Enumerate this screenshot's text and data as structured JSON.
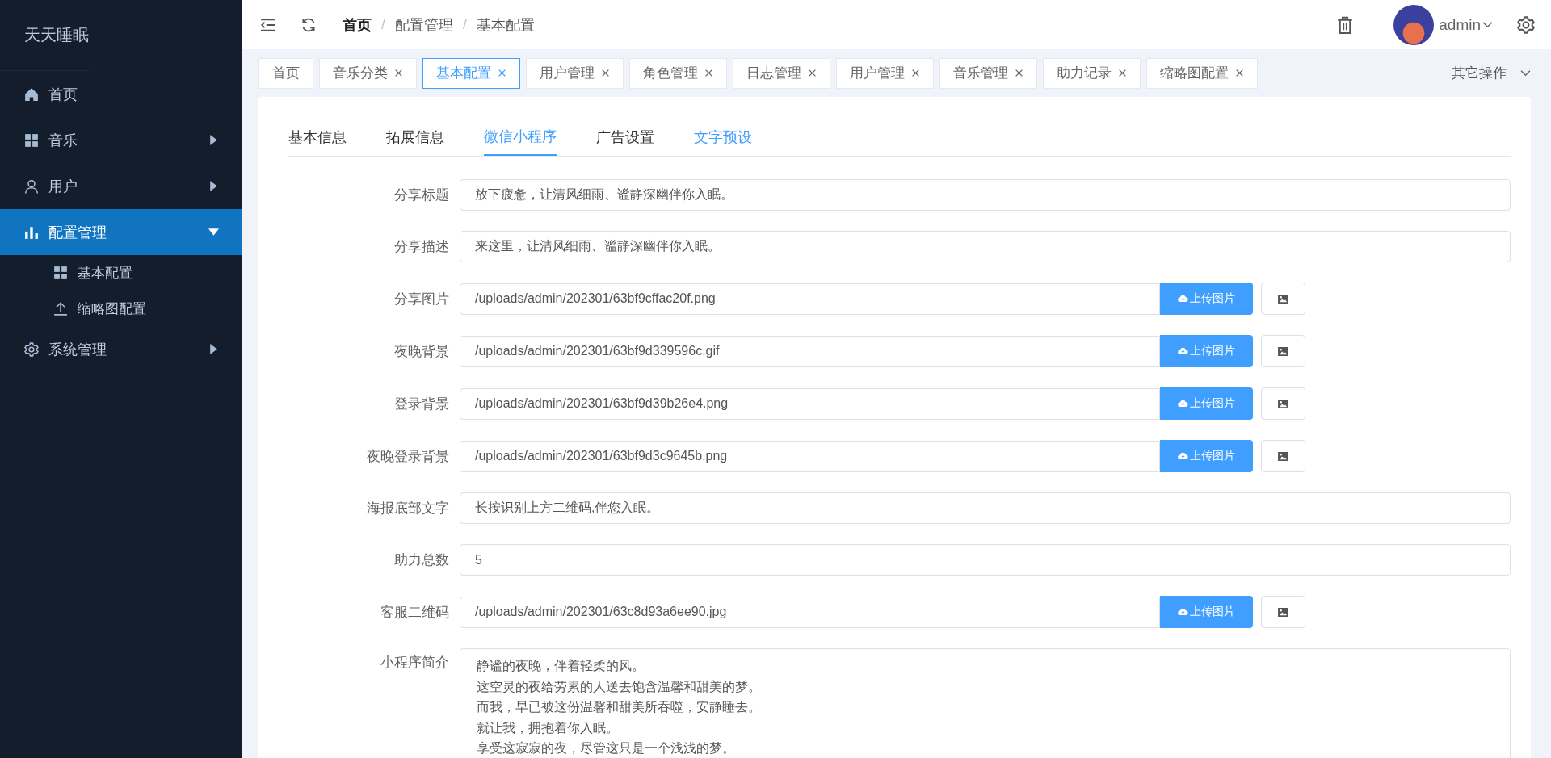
{
  "sidebar": {
    "title": "天天睡眠",
    "items": [
      {
        "label": "首页",
        "selected": false
      },
      {
        "label": "音乐",
        "selected": false,
        "expanded": false
      },
      {
        "label": "用户",
        "selected": false,
        "expanded": false
      },
      {
        "label": "配置管理",
        "selected": true,
        "expanded": true,
        "children": [
          {
            "label": "基本配置",
            "selected": false
          },
          {
            "label": "缩略图配置",
            "selected": false
          }
        ]
      },
      {
        "label": "系统管理",
        "selected": false,
        "expanded": false
      }
    ]
  },
  "header": {
    "breadcrumb": [
      {
        "label": "首页"
      },
      {
        "separator": "/",
        "label": "配置管理"
      },
      {
        "separator": "/",
        "label": "基本配置"
      }
    ],
    "user": "admin"
  },
  "tabs": [
    {
      "label": "首页",
      "closable": false,
      "selected": false
    },
    {
      "label": "音乐分类",
      "closable": true,
      "selected": false
    },
    {
      "label": "基本配置",
      "closable": true,
      "selected": true
    },
    {
      "label": "用户管理",
      "closable": true,
      "selected": false
    },
    {
      "label": "角色管理",
      "closable": true,
      "selected": false
    },
    {
      "label": "日志管理",
      "closable": true,
      "selected": false
    },
    {
      "label": "用户管理",
      "closable": true,
      "selected": false
    },
    {
      "label": "音乐管理",
      "closable": true,
      "selected": false
    },
    {
      "label": "助力记录",
      "closable": true,
      "selected": false
    },
    {
      "label": "缩略图配置",
      "closable": true,
      "selected": false
    }
  ],
  "tab_actions": "其它操作",
  "section_tabs": [
    {
      "label": "基本信息",
      "selected": false
    },
    {
      "label": "拓展信息",
      "selected": false
    },
    {
      "label": "微信小程序",
      "selected": true
    },
    {
      "label": "广告设置",
      "selected": false
    },
    {
      "label": "文字预设",
      "selected": false
    }
  ],
  "form": [
    {
      "kind": "text",
      "label": "分享标题",
      "value": "放下疲惫，让清风细雨、谧静深幽伴你入眠。"
    },
    {
      "kind": "text",
      "label": "分享描述",
      "value": "来这里，让清风细雨、谧静深幽伴你入眠。"
    },
    {
      "kind": "image",
      "label": "分享图片",
      "value": "/uploads/admin/202301/63bf9cffac20f.png",
      "button": "上传图片"
    },
    {
      "kind": "image",
      "label": "夜晚背景",
      "value": "/uploads/admin/202301/63bf9d339596c.gif",
      "button": "上传图片"
    },
    {
      "kind": "image",
      "label": "登录背景",
      "value": "/uploads/admin/202301/63bf9d39b26e4.png",
      "button": "上传图片"
    },
    {
      "kind": "image",
      "label": "夜晚登录背景",
      "value": "/uploads/admin/202301/63bf9d3c9645b.png",
      "button": "上传图片"
    },
    {
      "kind": "text",
      "label": "海报底部文字",
      "value": "长按识别上方二维码,伴您入眠。"
    },
    {
      "kind": "text",
      "label": "助力总数",
      "value": "5"
    },
    {
      "kind": "image",
      "label": "客服二维码",
      "value": "/uploads/admin/202301/63c8d93a6ee90.jpg",
      "button": "上传图片"
    },
    {
      "kind": "textarea",
      "label": "小程序简介",
      "lines": [
        "静谧的夜晚，伴着轻柔的风。",
        "这空灵的夜给劳累的人送去饱含温馨和甜美的梦。",
        "而我，早已被这份温馨和甜美所吞噬，安静睡去。",
        "就让我，拥抱着你入眠。",
        "享受这寂寂的夜，尽管这只是一个浅浅的梦。"
      ]
    }
  ]
}
